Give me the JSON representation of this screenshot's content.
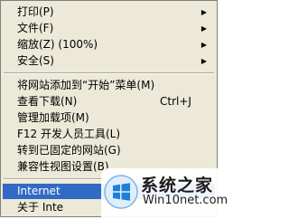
{
  "menu": {
    "items": [
      {
        "label": "打印(P)",
        "submenu": true
      },
      {
        "label": "文件(F)",
        "submenu": true
      },
      {
        "label": "缩放(Z) (100%)",
        "submenu": true
      },
      {
        "label": "安全(S)",
        "submenu": true
      },
      {
        "label": "将网站添加到“开始”菜单(M)"
      },
      {
        "label": "查看下载(N)",
        "shortcut": "Ctrl+J"
      },
      {
        "label": "管理加载项(M)"
      },
      {
        "label": "F12 开发人员工具(L)"
      },
      {
        "label": "转到已固定的网站(G)"
      },
      {
        "label": "兼容性视图设置(B)"
      },
      {
        "label": "Internet",
        "selected": true
      },
      {
        "label": "关于 Inte"
      }
    ],
    "arrow_glyph": "▶"
  },
  "watermark": {
    "title": "系统之家",
    "url": "Win10net.com"
  },
  "colors": {
    "menu_bg": "#ece9d8",
    "highlight": "#316ac5"
  }
}
